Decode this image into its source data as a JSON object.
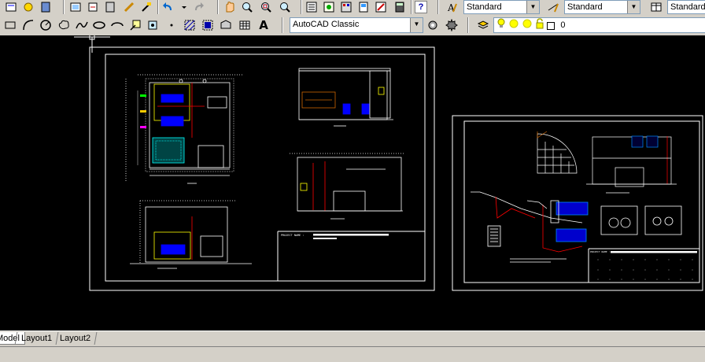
{
  "toolbar": {
    "text_style": "Standard",
    "dim_style": "Standard",
    "table_style": "Standard",
    "workspace": "AutoCAD Classic",
    "layer_name": "0",
    "colors": {
      "face": "#d4d0c8",
      "shadow": "#808080",
      "field": "#ffffff"
    }
  },
  "tabs": [
    {
      "label": "Model"
    },
    {
      "label": "Layout1"
    },
    {
      "label": "Layout2"
    }
  ],
  "drawing": {
    "left_sheet": {
      "title_text": "PROJECT NAME :"
    },
    "right_sheet": {
      "title_text": "PROJECT NAME :"
    },
    "colors": {
      "background": "#000000",
      "lines": "#ffffff",
      "accent_blue": "#0000ff",
      "accent_red": "#ff0000",
      "accent_yellow": "#ffff00",
      "accent_cyan": "#00ffff"
    }
  }
}
